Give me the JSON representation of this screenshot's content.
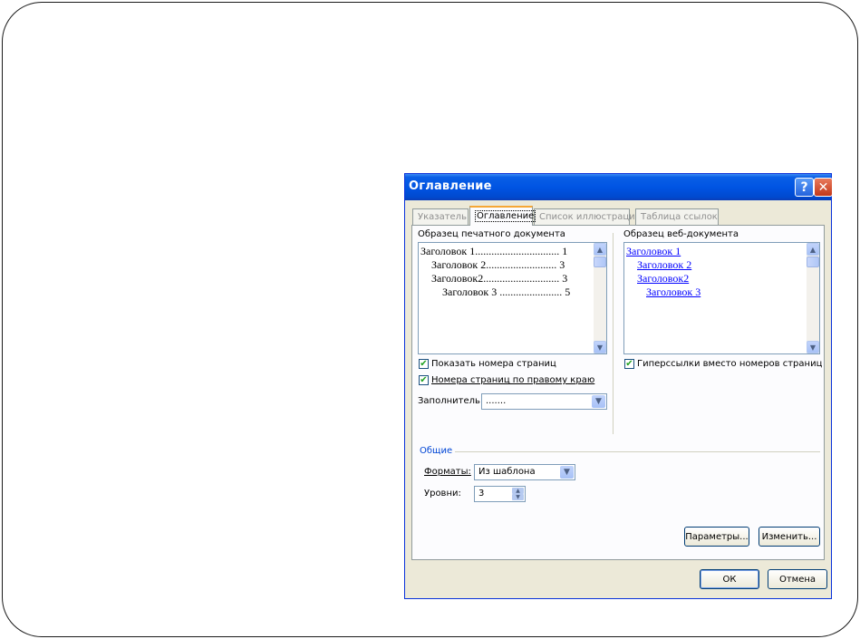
{
  "dialog": {
    "title": "Оглавление",
    "help_glyph": "?",
    "close_glyph": "✕"
  },
  "tabs": [
    {
      "label": "Указатель",
      "active": false
    },
    {
      "label": "Оглавление",
      "active": true
    },
    {
      "label": "Список иллюстраций",
      "active": false
    },
    {
      "label": "Таблица ссылок",
      "active": false
    }
  ],
  "print_preview": {
    "label": "Образец печатного документа",
    "lines": [
      "Заголовок 1............................... 1",
      "Заголовок 2.......................... 3",
      "Заголовок2............................ 3",
      "Заголовок 3 ....................... 5"
    ]
  },
  "web_preview": {
    "label": "Образец веб-документа",
    "links": [
      "Заголовок 1",
      "Заголовок 2",
      "Заголовок2",
      "Заголовок 3"
    ]
  },
  "options": {
    "show_page_numbers": {
      "label": "Показать номера страниц",
      "checked": true
    },
    "right_align": {
      "label": "Номера страниц по правому краю",
      "checked": true
    },
    "hyperlinks": {
      "label": "Гиперссылки вместо номеров страниц",
      "checked": true
    },
    "leader_label": "Заполнитель:",
    "leader_value": "......."
  },
  "general": {
    "title": "Общие",
    "formats_label": "Форматы:",
    "formats_value": "Из шаблона",
    "levels_label": "Уровни:",
    "levels_value": "3"
  },
  "buttons": {
    "params": "Параметры...",
    "modify": "Изменить...",
    "ok": "ОК",
    "cancel": "Отмена"
  },
  "colors": {
    "titlebar": "#0054e3",
    "dialog_bg": "#ece9d8",
    "link": "#0000ff",
    "group_title": "#0046d5",
    "active_tab_accent": "#f6a735"
  },
  "icons": {
    "help": "help-icon",
    "close": "close-icon",
    "check": "checkmark-icon",
    "dropdown": "chevron-down-icon",
    "scroll_up": "chevron-up-icon"
  }
}
